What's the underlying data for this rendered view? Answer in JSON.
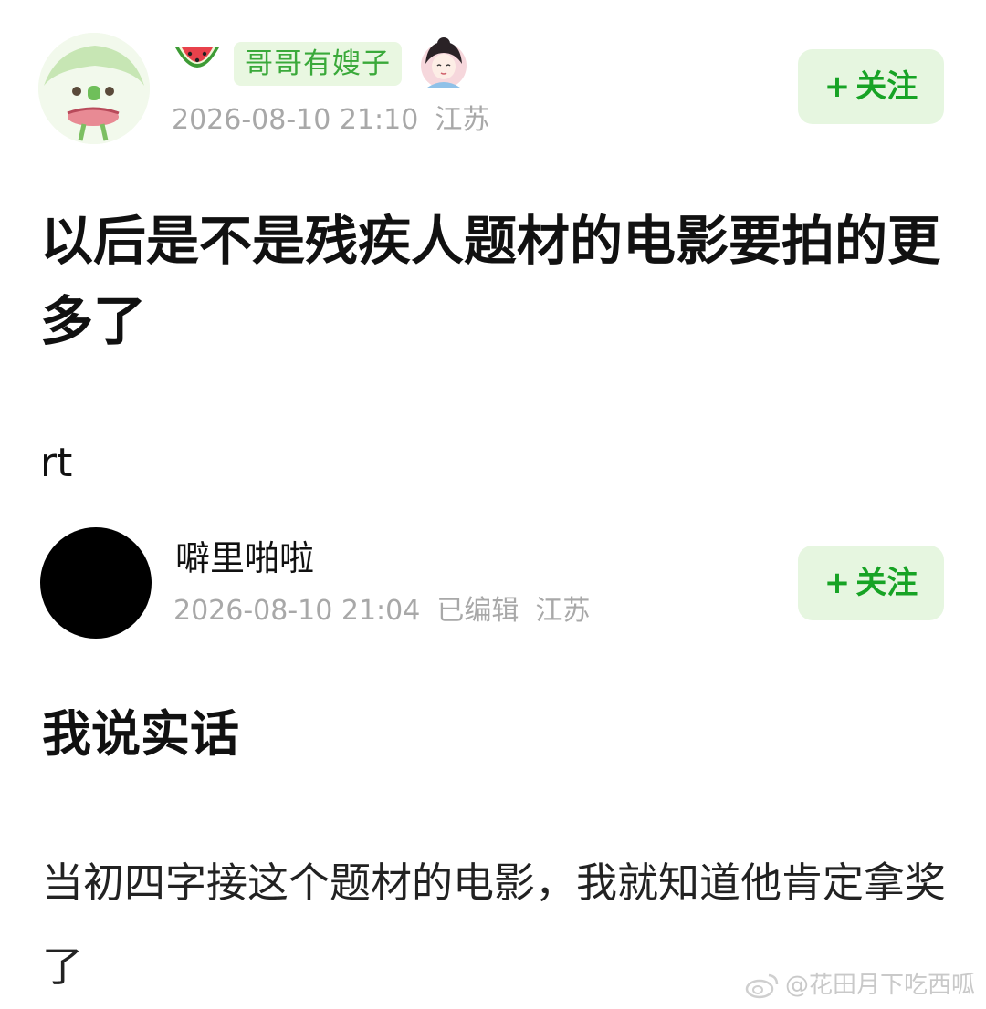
{
  "post": {
    "username": "哥哥有嫂子",
    "timestamp": "2026-08-10 21:10",
    "location": "江苏",
    "follow_plus": "+",
    "follow_label": "关注",
    "title": "以后是不是残疾人题材的电影要拍的更多了",
    "body": "rt"
  },
  "reply": {
    "username": "噼里啪啦",
    "timestamp": "2026-08-10 21:04",
    "edited": "已编辑",
    "location": "江苏",
    "follow_plus": "+",
    "follow_label": "关注",
    "title": "我说实话",
    "body": "当初四字接这个题材的电影，我就知道他肯定拿奖了"
  },
  "watermark": "@花田月下吃西呱",
  "colors": {
    "accent_green": "#17a325",
    "badge_bg": "#e9f7e1",
    "meta_gray": "#a8a8a8"
  },
  "icons": [
    "sticker-avatar",
    "watermelon-icon",
    "character-avatar",
    "weibo-icon"
  ]
}
